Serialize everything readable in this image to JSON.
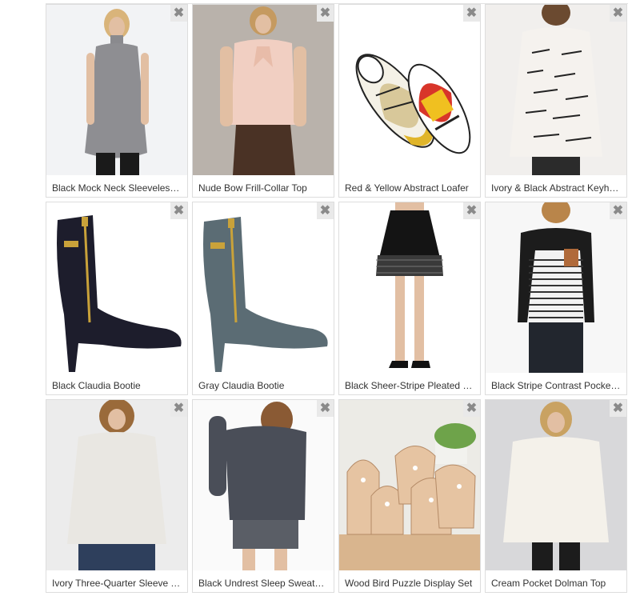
{
  "close_glyph": "✖",
  "products": [
    {
      "title": "Black Mock Neck Sleeveless Tunic",
      "image": "gray-sleeveless-tunic",
      "bg": "#f2f3f5"
    },
    {
      "title": "Nude Bow Frill-Collar Top",
      "image": "nude-bow-top",
      "bg": "#b9b2ab"
    },
    {
      "title": "Red & Yellow Abstract Loafer",
      "image": "abstract-loafers",
      "bg": "#ffffff"
    },
    {
      "title": "Ivory & Black Abstract Keyhole Top",
      "image": "ivory-black-top",
      "bg": "#f1efed"
    },
    {
      "title": "Black Claudia Bootie",
      "image": "black-bootie",
      "bg": "#ffffff"
    },
    {
      "title": "Gray Claudia Bootie",
      "image": "gray-bootie",
      "bg": "#ffffff"
    },
    {
      "title": "Black Sheer-Stripe Pleated Skirt",
      "image": "black-skirt",
      "bg": "#ffffff"
    },
    {
      "title": "Black Stripe Contrast Pocket Top",
      "image": "stripe-top",
      "bg": "#f7f7f7"
    },
    {
      "title": "Ivory Three-Quarter Sleeve Tunic",
      "image": "ivory-tunic",
      "bg": "#ececec"
    },
    {
      "title": "Black Undrest Sleep Sweatshirt",
      "image": "gray-sweatshirt",
      "bg": "#fafafa"
    },
    {
      "title": "Wood Bird Puzzle Display Set",
      "image": "wood-birds",
      "bg": "#ecebe6"
    },
    {
      "title": "Cream Pocket Dolman Top",
      "image": "cream-dolman",
      "bg": "#d8d8da"
    }
  ]
}
